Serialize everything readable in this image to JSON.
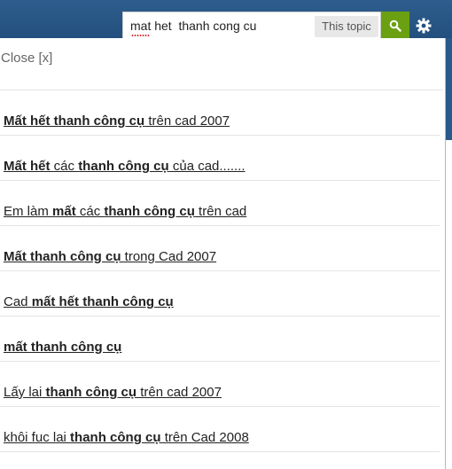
{
  "search": {
    "query": "mat het  thanh cong cu",
    "scope_label": "This topic"
  },
  "panel": {
    "close_label": "Close [x]"
  },
  "results": [
    [
      {
        "t": "Mất hết thanh công cụ",
        "b": true
      },
      {
        "t": " trên cad 2007",
        "b": false
      }
    ],
    [
      {
        "t": "Mất hết",
        "b": true
      },
      {
        "t": " các ",
        "b": false
      },
      {
        "t": "thanh công cụ",
        "b": true
      },
      {
        "t": " của cad.......",
        "b": false
      }
    ],
    [
      {
        "t": "Em làm ",
        "b": false
      },
      {
        "t": "mất",
        "b": true
      },
      {
        "t": " các ",
        "b": false
      },
      {
        "t": "thanh công cụ",
        "b": true
      },
      {
        "t": " trên cad",
        "b": false
      }
    ],
    [
      {
        "t": "Mất thanh công cụ",
        "b": true
      },
      {
        "t": " trong Cad 2007",
        "b": false
      }
    ],
    [
      {
        "t": "Cad ",
        "b": false
      },
      {
        "t": "mất hết thanh công cụ",
        "b": true
      }
    ],
    [
      {
        "t": "mất thanh công cụ",
        "b": true
      }
    ],
    [
      {
        "t": "Lấy lai ",
        "b": false
      },
      {
        "t": "thanh công cụ",
        "b": true
      },
      {
        "t": " trên cad 2007",
        "b": false
      }
    ],
    [
      {
        "t": "khôi fuc lai ",
        "b": false
      },
      {
        "t": "thanh công cụ",
        "b": true
      },
      {
        "t": " trên Cad 2008",
        "b": false
      }
    ]
  ],
  "icons": {
    "search": "search-icon",
    "settings": "gear-icon"
  },
  "colors": {
    "header": "#2a5a8a",
    "search_button": "#6aa012",
    "scope_button": "#e8e8e8"
  }
}
